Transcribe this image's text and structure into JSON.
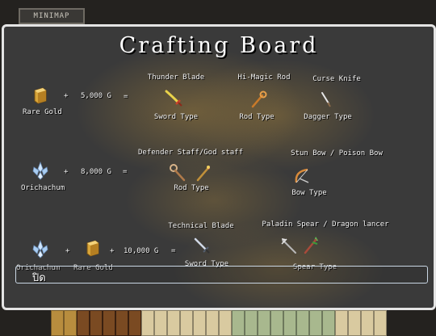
{
  "minimap": {
    "label": "MINIMAP"
  },
  "board": {
    "title": "Crafting Board",
    "close_label": "ปิด",
    "plus": "+",
    "equals": "=",
    "recipes": [
      {
        "ingredients": [
          {
            "name": "Rare Gold",
            "icon": "gold-ingot-icon"
          }
        ],
        "cost": "5,000 G",
        "results": [
          {
            "name": "Thunder Blade",
            "type": "Sword Type",
            "icon": "sword-icon"
          },
          {
            "name": "Hi-Magic Rod",
            "type": "Rod Type",
            "icon": "rod-icon"
          },
          {
            "name": "Curse Knife",
            "type": "Dagger Type",
            "icon": "dagger-icon"
          }
        ]
      },
      {
        "ingredients": [
          {
            "name": "Orichachum",
            "icon": "crystal-icon"
          }
        ],
        "cost": "8,000 G",
        "results": [
          {
            "name": "Defender Staff/God staff",
            "type": "Rod Type",
            "icon": "staff-icon"
          },
          {
            "name": "Stun Bow / Poison Bow",
            "type": "Bow Type",
            "icon": "bow-icon"
          }
        ]
      },
      {
        "ingredients": [
          {
            "name": "Orichachum",
            "icon": "crystal-icon"
          },
          {
            "name": "Rare Gold",
            "icon": "gold-ingot-icon"
          }
        ],
        "cost": "10,000 G",
        "results": [
          {
            "name": "Technical Blade",
            "type": "Sword Type",
            "icon": "blade-icon"
          },
          {
            "name": "Paladin Spear / Dragon lancer",
            "type": "Spear Type",
            "icon": "spear-icon"
          }
        ]
      }
    ]
  }
}
